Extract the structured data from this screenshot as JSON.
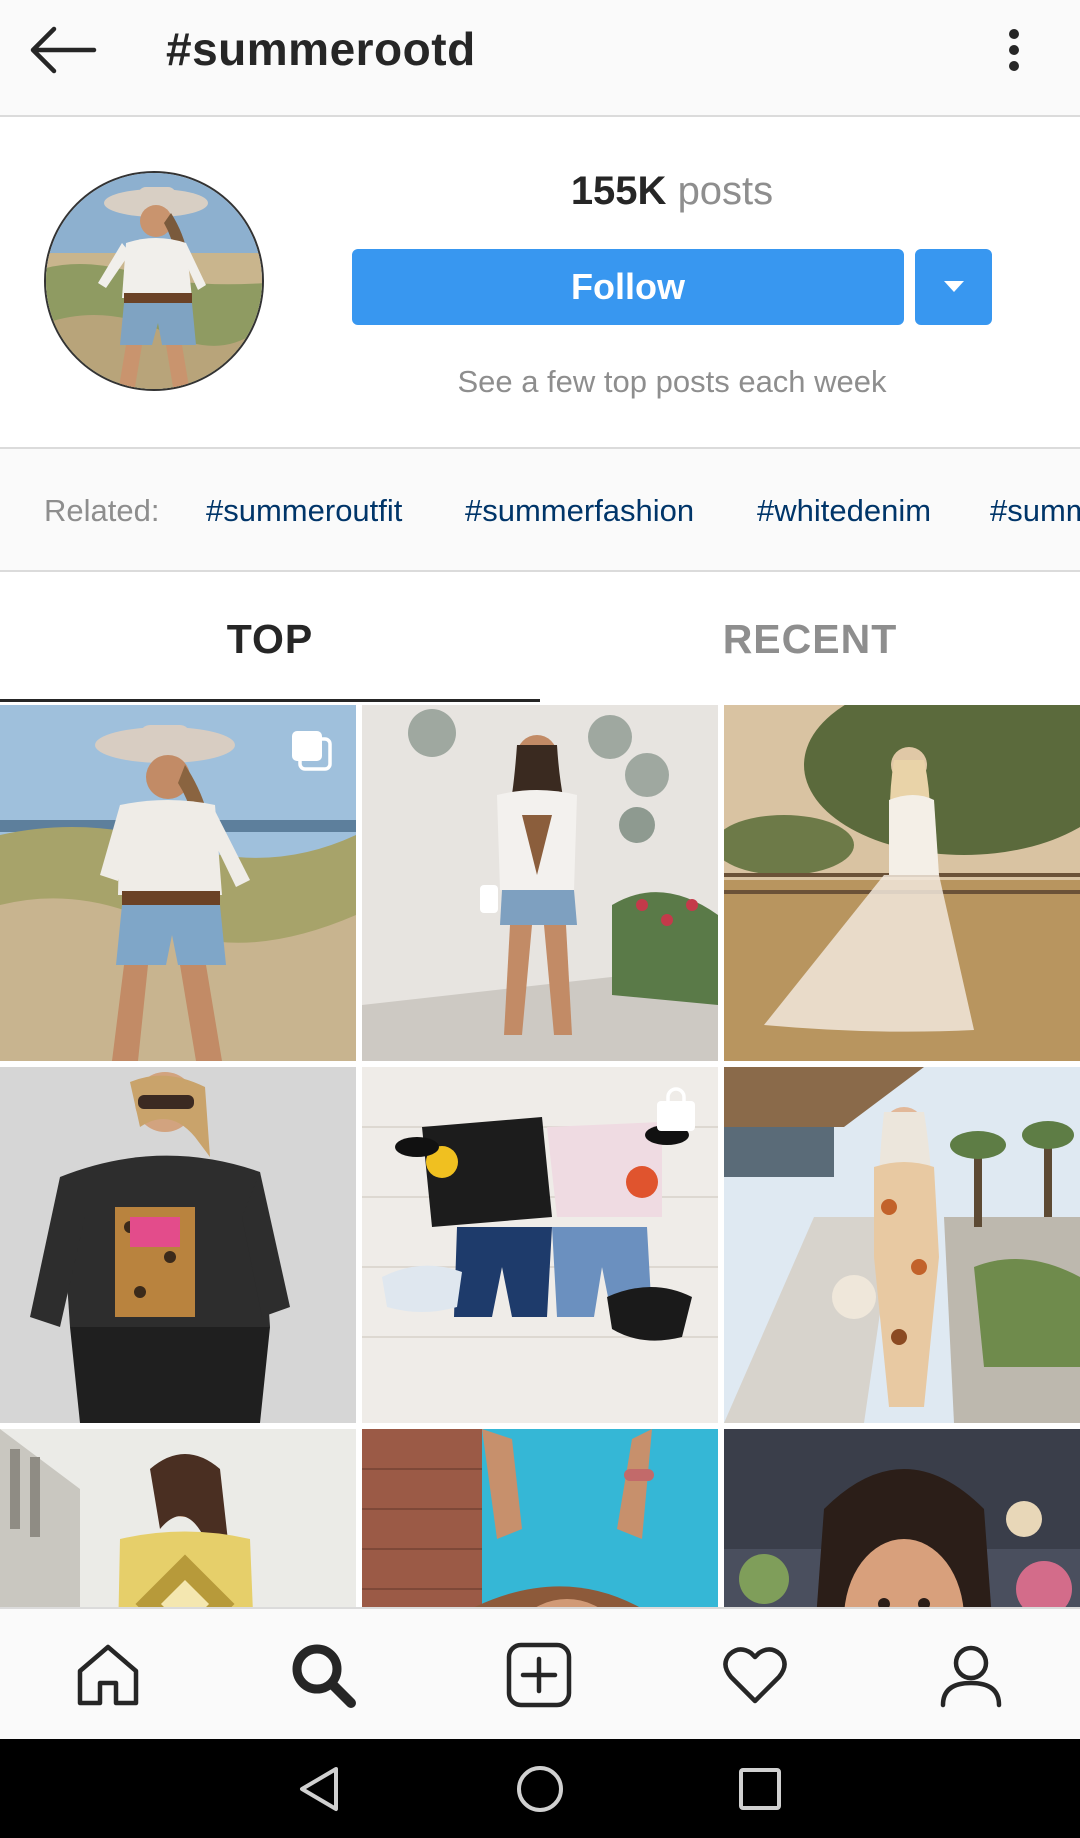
{
  "topbar": {
    "title": "#summerootd",
    "back_icon": "arrow-left-icon",
    "more_icon": "more-vertical-icon"
  },
  "header": {
    "posts_count": "155K",
    "posts_label": "posts",
    "follow_label": "Follow",
    "dropdown_icon": "caret-down-icon",
    "subtitle": "See a few top posts each week"
  },
  "related": {
    "label": "Related:",
    "tags": [
      "#summeroutfit",
      "#summerfashion",
      "#whitedenim",
      "#summ"
    ]
  },
  "tabs": {
    "items": [
      {
        "label": "TOP",
        "active": true
      },
      {
        "label": "RECENT",
        "active": false
      }
    ]
  },
  "grid": {
    "posts": [
      {
        "name": "post-beach-lace-top",
        "badge": "multiple-photos-icon"
      },
      {
        "name": "post-wall-plates-tee",
        "badge": ""
      },
      {
        "name": "post-sheer-gown-field",
        "badge": ""
      },
      {
        "name": "post-bing-sweatshirt",
        "badge": ""
      },
      {
        "name": "post-flatlay-shorts",
        "badge": "shopping-bag-icon"
      },
      {
        "name": "post-floral-jumpsuit",
        "badge": ""
      },
      {
        "name": "post-printed-top",
        "badge": ""
      },
      {
        "name": "post-raised-arms",
        "badge": ""
      },
      {
        "name": "post-smiling-woman",
        "badge": ""
      }
    ]
  },
  "bottom_nav": {
    "items": [
      {
        "icon": "home-icon"
      },
      {
        "icon": "search-icon",
        "active": true
      },
      {
        "icon": "add-post-icon"
      },
      {
        "icon": "heart-icon"
      },
      {
        "icon": "profile-icon"
      }
    ]
  },
  "system_nav": {
    "items": [
      {
        "icon": "android-back-icon"
      },
      {
        "icon": "android-home-icon"
      },
      {
        "icon": "android-recents-icon"
      }
    ]
  },
  "colors": {
    "accent": "#3897f0",
    "hashtag": "#003569",
    "muted": "#8e8e8e",
    "text": "#262626",
    "divider": "#dbdbdb"
  }
}
